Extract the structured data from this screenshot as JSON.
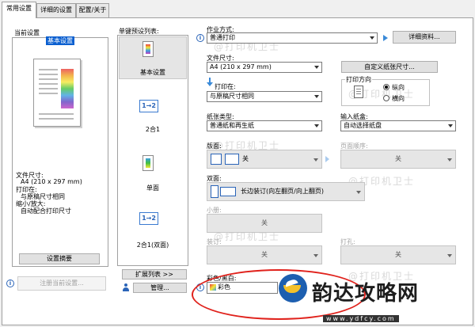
{
  "tabs": [
    "常用设置",
    "详细的设置",
    "配置/关于"
  ],
  "left": {
    "current_settings_label": "当前设置",
    "preset_badge": "基本设置",
    "summary_lines": [
      "文件尺寸:",
      "A4 (210 x 297 mm)",
      "打印在:",
      "与原稿尺寸相同",
      "缩小/放大:",
      "自动配合打印尺寸"
    ],
    "settings_summary_button": "设置摘要",
    "register_button": "注册当前设置..."
  },
  "presets": {
    "label": "单键预设列表:",
    "items": [
      "基本设置",
      "2合1",
      "单面",
      "2合1(双面)"
    ],
    "expand_button": "扩展列表 >>",
    "manage_button": "管理..."
  },
  "job": {
    "label": "作业方式:",
    "value": "普通打印",
    "details_button": "详细资料..."
  },
  "paper_size": {
    "label": "文件尺寸:",
    "value": "A4 (210 x 297 mm)",
    "custom_button": "自定义纸张尺寸..."
  },
  "print_on": {
    "label": "打印在:",
    "value": "与原稿尺寸相同"
  },
  "orientation": {
    "label": "打印方向",
    "options": [
      "纵向",
      "横向"
    ],
    "selected": 0
  },
  "paper_type": {
    "label": "纸张类型:",
    "value": "普通纸和再生纸"
  },
  "paper_source": {
    "label": "输入纸盒:",
    "value": "自动选择纸盘"
  },
  "layout": {
    "label": "版面:",
    "value": "关"
  },
  "page_order": {
    "label": "页面顺序:",
    "value": "关"
  },
  "duplex": {
    "label": "双面:",
    "value": "长边装订(向左翻页/向上翻页)"
  },
  "booklet": {
    "label": "小册:",
    "value": "关"
  },
  "staple": {
    "label": "装订:",
    "value": "关"
  },
  "punch": {
    "label": "打孔:",
    "value": "关"
  },
  "color": {
    "label": "彩色/黑白:",
    "value": "彩色"
  },
  "logo": {
    "text": "韵达攻略网",
    "url": "www.ydfcy.com"
  },
  "watermark_text": "@打印机卫士",
  "colors": {
    "accent_blue": "#2a64b8",
    "annotation_red": "#e0221c",
    "logo_blue": "#1d5fb0"
  }
}
